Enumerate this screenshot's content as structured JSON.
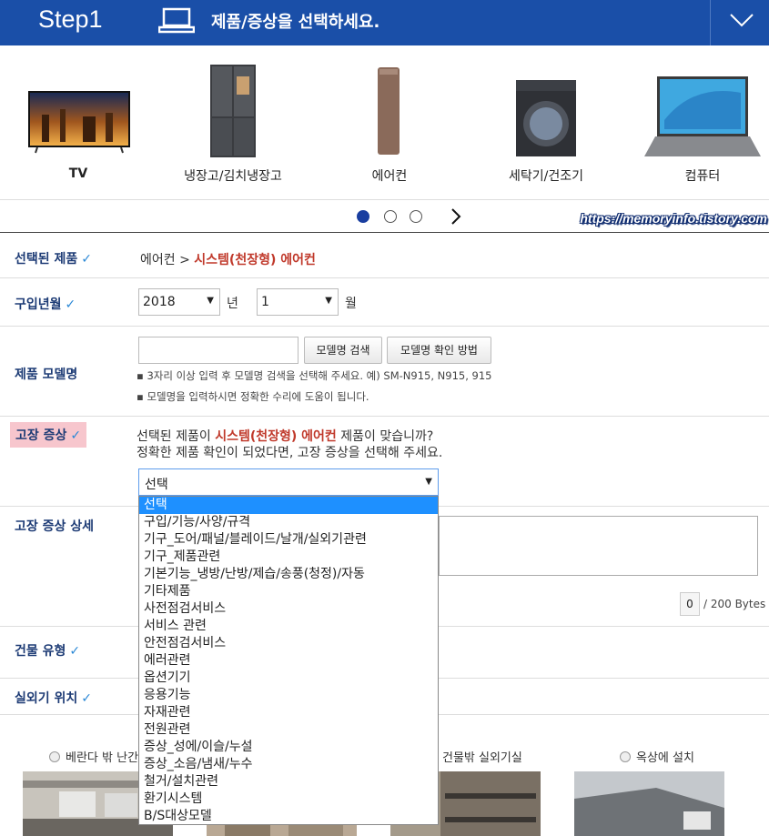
{
  "header": {
    "step": "Step1",
    "title": "제품/증상을 선택하세요.",
    "device_icon": "laptop-icon",
    "toggle_icon": "chevron-down-icon"
  },
  "products": [
    {
      "label": "TV"
    },
    {
      "label": "냉장고/김치냉장고"
    },
    {
      "label": "에어컨"
    },
    {
      "label": "세탁기/건조기"
    },
    {
      "label": "컴퓨터"
    }
  ],
  "pager": {
    "pages": 3,
    "active": 1
  },
  "watermark": "https://memoryinfo.tistory.com",
  "selected_product": {
    "label": "선택된 제품",
    "category": "에어컨",
    "separator": " > ",
    "product": "시스템(천장형) 에어컨"
  },
  "purchase": {
    "label": "구입년월",
    "year": "2018",
    "year_unit": "년",
    "month": "1",
    "month_unit": "월"
  },
  "model": {
    "label": "제품 모델명",
    "input_value": "",
    "search_button": "모델명 검색",
    "howto_button": "모델명 확인 방법",
    "hint1": "3자리 이상 입력 후 모델명 검색을 선택해 주세요. 예) SM-N915, N915, 915",
    "hint2": "모델명을 입력하시면 정확한 수리에 도움이 됩니다."
  },
  "symptom": {
    "label": "고장 증상",
    "q_prefix": "선택된 제품이 ",
    "q_product": "시스템(천장형) 에어컨",
    "q_suffix": " 제품이 맞습니까?",
    "q_line2": "정확한 제품 확인이 되었다면, 고장 증상을 선택해 주세요.",
    "selected": "선택",
    "options": [
      "선택",
      "구입/기능/사양/규격",
      "기구_도어/패널/블레이드/날개/실외기관련",
      "기구_제품관련",
      "기본기능_냉방/난방/제습/송풍(청정)/자동",
      "기타제품",
      "사전점검서비스",
      "서비스 관련",
      "안전점검서비스",
      "에러관련",
      "옵션기기",
      "응용기능",
      "자재관련",
      "전원관련",
      "증상_성에/이슬/누설",
      "증상_소음/냄새/누수",
      "철거/설치관련",
      "환기시스템",
      "B/S대상모델"
    ]
  },
  "detail": {
    "label": "고장 증상 상세",
    "count": "0",
    "limit": "/ 200 Bytes"
  },
  "building": {
    "label": "건물 유형"
  },
  "outdoor": {
    "label": "실외기 위치",
    "options": [
      "베란다 밖 난간",
      "건물밖 실외기실",
      "옥상에 설치"
    ]
  },
  "check_icon": "check-icon"
}
